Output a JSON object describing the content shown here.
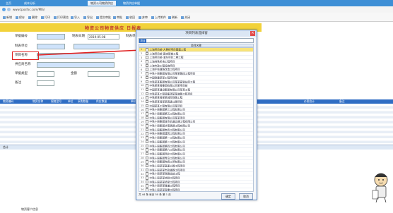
{
  "tabs": [
    {
      "label": "主页"
    },
    {
      "label": "成本分析"
    },
    {
      "label": "物资公司物资供应"
    },
    {
      "label": "物资供应单据"
    }
  ],
  "address": {
    "url": "www.tposfoc.com/MIS/"
  },
  "toolbar": [
    {
      "label": "新增"
    },
    {
      "label": "保存"
    },
    {
      "label": "删除"
    },
    {
      "label": "打印"
    },
    {
      "label": "打印预览"
    },
    {
      "label": "导入"
    },
    {
      "label": "导出"
    },
    {
      "label": "提交审批"
    },
    {
      "label": "审批"
    },
    {
      "label": "收回"
    },
    {
      "label": "弃审"
    },
    {
      "label": "上传附件"
    },
    {
      "label": "刷新"
    },
    {
      "label": "关闭"
    }
  ],
  "form": {
    "title": "物资公司物资供应  日报表",
    "labels": {
      "doc_no": "单据编号",
      "date": "制表日期",
      "dept": "制表单位",
      "project": "项目名称",
      "supplier": "供应商名称",
      "bill_type": "单据类型",
      "amount": "金额",
      "remark": "备注"
    },
    "values": {
      "date": "2019-05-08"
    }
  },
  "grid": {
    "columns": [
      "物资编码",
      "物资名称",
      "规格型号",
      "单位",
      "采购数量",
      "供应数量",
      "单价",
      "金额",
      "税率",
      "税额",
      "价税合计",
      "备注"
    ],
    "status_left": "合计"
  },
  "dialog": {
    "title": "项目列表选择窗",
    "search_tag": "项目",
    "header": "项目名称",
    "rows": [
      "上海项目部-大黄桥项目基建工程",
      "上海项目部-嘉定新城工程",
      "上海项目部-浦东项目二期工程",
      "上海地铁机电工程项目",
      "上海市政工程设施项目",
      "上海环线道路改造工程项目",
      "中铁十局集团有限公司某某路段工程项目",
      "中国铁建某某工程项目部",
      "中铁某某集团有限公司某某高铁站房工程",
      "中铁某某局集团有限公司某项目部",
      "中国某某建设集团有限公司某某工程",
      "中铁某某工程局集团某某道路工程项目",
      "中铁某某局某某城际铁路工程",
      "中铁某某局某某高速公路项目",
      "中国某某工程有限公司某项目",
      "中铁十局集团第三工程有限公司",
      "中铁十局集团第五工程有限公司",
      "中铁十局集团有限公司某某项目",
      "中铁十局集团城市轨道交通工程有限公司",
      "中铁十局集团济南铁路工程有限公司",
      "中铁十局集团电务工程有限公司",
      "中铁十局集团建筑工程有限公司",
      "中铁十局集团第一工程有限公司",
      "中铁十局集团第二工程有限公司",
      "中铁十局集团第四工程有限公司",
      "中铁十局集团第六工程有限公司",
      "中铁十局集团西北工程有限公司",
      "中铁十局集团青岛工程有限公司",
      "中铁十局集团物资工贸有限公司",
      "中铁十局某某高速公路工程项目",
      "中铁十局某某市政道路工程项目",
      "中铁十局某某铁路站前工程",
      "中铁十局某某地铁工程项目",
      "中铁十局某某桥梁工程项目",
      "中铁十局某某隧道工程项目",
      "中铁十局某某房建工程项目",
      "中铁十局某某综合管廊项目",
      "中铁十局某某新区基础设施项目",
      "中铁十局某某水利工程项目",
      "中铁十局某某港口工程项目",
      "中铁十局某某机场工程项目",
      "中铁十局某某城市更新项目",
      "中铁十局某某轨道交通项目"
    ],
    "selected_index": 0,
    "pager": "共 44 条  每页 50 条  第 1 页",
    "ok_label": "确定",
    "cancel_label": "取消"
  },
  "footer": {
    "text": "物资客户信息"
  }
}
